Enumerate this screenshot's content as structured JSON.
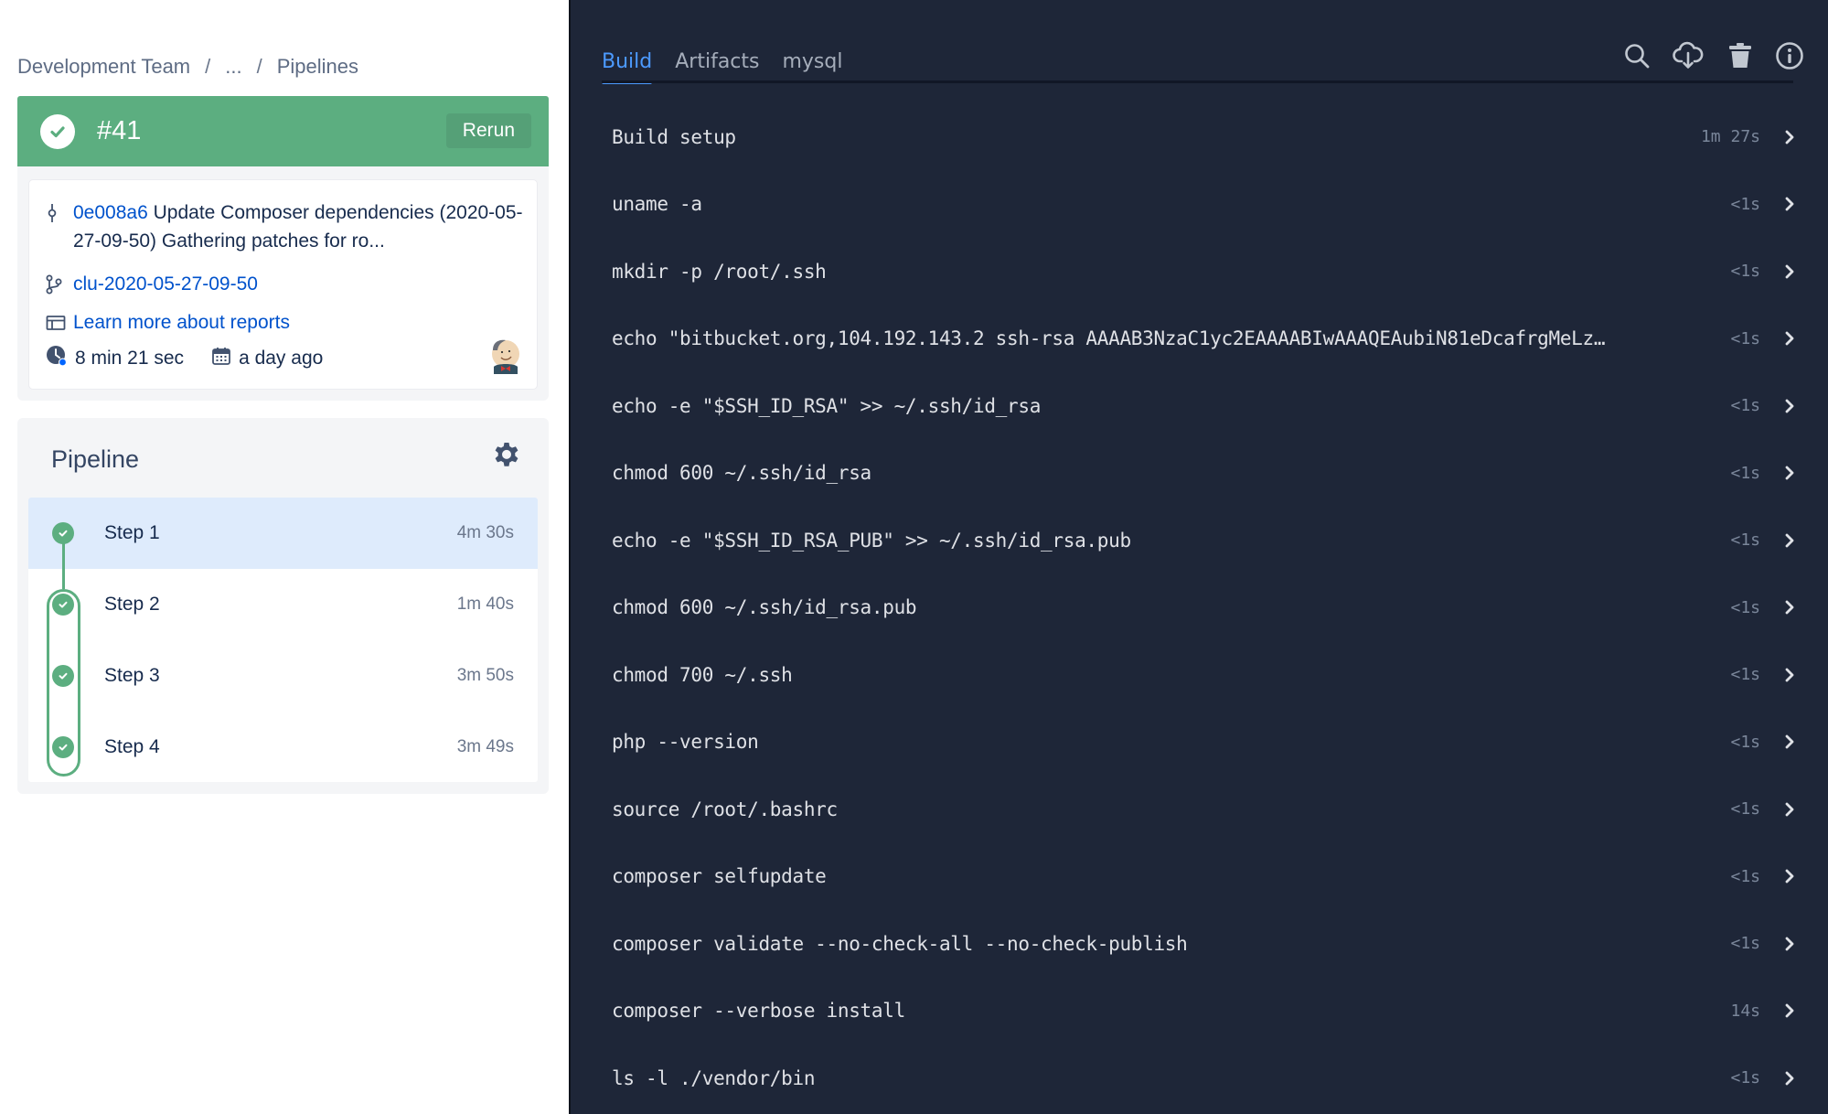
{
  "breadcrumb": {
    "items": [
      "Development Team",
      "...",
      "Pipelines"
    ],
    "separator": "/"
  },
  "run": {
    "number": "#41",
    "status": "successful",
    "rerun_label": "Rerun",
    "commit_hash": "0e008a6",
    "commit_message": "Update Composer dependencies (2020-05-27-09-50) Gathering patches for ro...",
    "branch": "clu-2020-05-27-09-50",
    "reports_link": "Learn more about reports",
    "duration": "8 min 21 sec",
    "started": "a day ago",
    "avatar_icon": "jenkins-avatar-icon"
  },
  "pipeline": {
    "title": "Pipeline",
    "settings_icon": "gear-icon",
    "steps": [
      {
        "name": "Step 1",
        "time": "4m 30s",
        "status": "success",
        "selected": true
      },
      {
        "name": "Step 2",
        "time": "1m 40s",
        "status": "success",
        "selected": false
      },
      {
        "name": "Step 3",
        "time": "3m 50s",
        "status": "success",
        "selected": false
      },
      {
        "name": "Step 4",
        "time": "3m 49s",
        "status": "success",
        "selected": false
      }
    ]
  },
  "log_panel": {
    "tabs": [
      {
        "label": "Build",
        "active": true
      },
      {
        "label": "Artifacts",
        "active": false
      },
      {
        "label": "mysql",
        "active": false
      }
    ],
    "toolbar": [
      "search-icon",
      "cloud-download-icon",
      "trash-icon",
      "info-icon"
    ],
    "rows": [
      {
        "cmd": "Build setup",
        "time": "1m 27s"
      },
      {
        "cmd": "uname -a",
        "time": "<1s"
      },
      {
        "cmd": "mkdir -p /root/.ssh",
        "time": "<1s"
      },
      {
        "cmd": "echo \"bitbucket.org,104.192.143.2 ssh-rsa AAAAB3NzaC1yc2EAAAABIwAAAQEAubiN81eDcafrgMeLz…",
        "time": "<1s"
      },
      {
        "cmd": "echo -e \"$SSH_ID_RSA\" >> ~/.ssh/id_rsa",
        "time": "<1s"
      },
      {
        "cmd": "chmod 600 ~/.ssh/id_rsa",
        "time": "<1s"
      },
      {
        "cmd": "echo -e \"$SSH_ID_RSA_PUB\" >> ~/.ssh/id_rsa.pub",
        "time": "<1s"
      },
      {
        "cmd": "chmod 600 ~/.ssh/id_rsa.pub",
        "time": "<1s"
      },
      {
        "cmd": "chmod 700 ~/.ssh",
        "time": "<1s"
      },
      {
        "cmd": "php --version",
        "time": "<1s"
      },
      {
        "cmd": "source /root/.bashrc",
        "time": "<1s"
      },
      {
        "cmd": "composer selfupdate",
        "time": "<1s"
      },
      {
        "cmd": "composer validate --no-check-all --no-check-publish",
        "time": "<1s"
      },
      {
        "cmd": "composer --verbose install",
        "time": "14s"
      },
      {
        "cmd": "ls -l ./vendor/bin",
        "time": "<1s"
      }
    ]
  },
  "colors": {
    "success_green": "#5cae80",
    "link_blue": "#0052cc",
    "active_tab_blue": "#4c9aff",
    "log_background": "#1e2638",
    "selected_step_bg": "#deebfc"
  }
}
